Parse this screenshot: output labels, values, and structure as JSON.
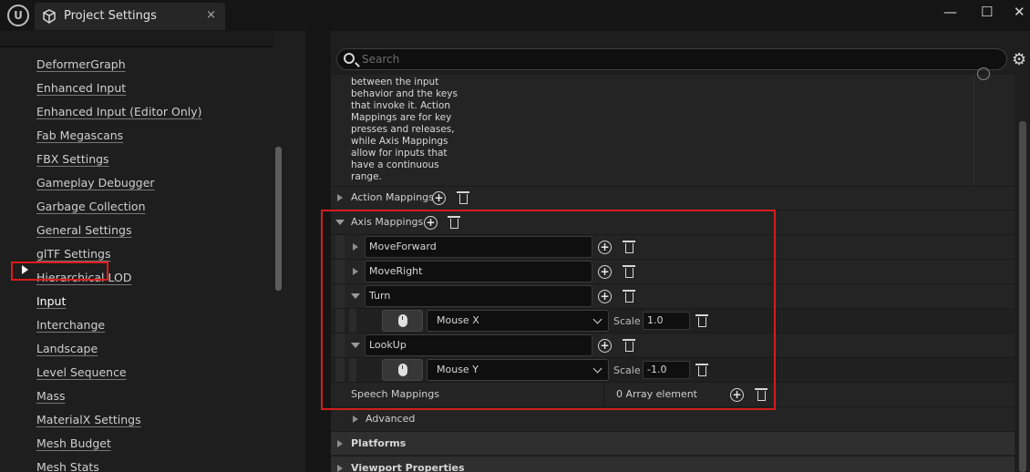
{
  "window": {
    "logo_text": "U",
    "tab_title": "Project Settings",
    "close_glyph": "×",
    "minimize_glyph": "—",
    "maximize_glyph": "☐",
    "window_close_glyph": "✕"
  },
  "sidebar": {
    "items": [
      {
        "label": "DeformerGraph"
      },
      {
        "label": "Enhanced Input"
      },
      {
        "label": "Enhanced Input (Editor Only)"
      },
      {
        "label": "Fab Megascans"
      },
      {
        "label": "FBX Settings"
      },
      {
        "label": "Gameplay Debugger"
      },
      {
        "label": "Garbage Collection"
      },
      {
        "label": "General Settings"
      },
      {
        "label": "glTF Settings"
      },
      {
        "label": "Hierarchical LOD"
      },
      {
        "label": "Input",
        "selected": true
      },
      {
        "label": "Interchange"
      },
      {
        "label": "Landscape"
      },
      {
        "label": "Level Sequence"
      },
      {
        "label": "Mass"
      },
      {
        "label": "MaterialX Settings"
      },
      {
        "label": "Mesh Budget"
      },
      {
        "label": "Mesh Stats"
      }
    ]
  },
  "search": {
    "placeholder": "Search"
  },
  "details": {
    "description": "between the input behavior and the keys that invoke it. Action Mappings are for key presses and releases, while Axis Mappings allow for inputs that have a continuous range.",
    "action_mappings_label": "Action Mappings",
    "axis_mappings_label": "Axis Mappings",
    "axis_mappings": [
      {
        "name": "MoveForward",
        "expanded": false
      },
      {
        "name": "MoveRight",
        "expanded": false
      },
      {
        "name": "Turn",
        "expanded": true,
        "key": "Mouse X",
        "scale_label": "Scale",
        "scale": "1.0"
      },
      {
        "name": "LookUp",
        "expanded": true,
        "key": "Mouse Y",
        "scale_label": "Scale",
        "scale": "-1.0"
      }
    ],
    "speech_mappings_label": "Speech Mappings",
    "speech_mappings_value": "0 Array element",
    "advanced_label": "Advanced",
    "sections": [
      "Platforms",
      "Viewport Properties"
    ]
  },
  "colors": {
    "highlight": "#e01a1a",
    "panel": "#1e1e1e",
    "row": "#242424"
  }
}
